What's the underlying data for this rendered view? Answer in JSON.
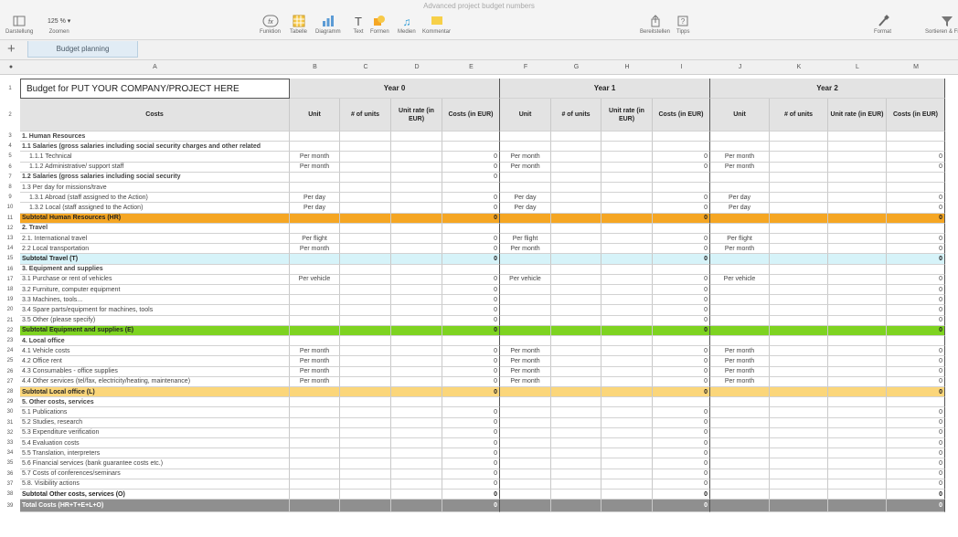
{
  "window_title": "Advanced project budget numbers",
  "toolbar": {
    "left": [
      {
        "label": "Darstellung",
        "icon": "sidebar-icon"
      },
      {
        "label": "Zoomen",
        "value": "125 %",
        "icon": "zoom-icon"
      }
    ],
    "center": [
      {
        "label": "Funktion",
        "icon": "function-icon"
      },
      {
        "label": "Tabelle",
        "icon": "table-icon"
      },
      {
        "label": "Diagramm",
        "icon": "chart-icon"
      },
      {
        "label": "Text",
        "icon": "text-icon"
      },
      {
        "label": "Formen",
        "icon": "shape-icon"
      },
      {
        "label": "Medien",
        "icon": "media-icon"
      },
      {
        "label": "Kommentar",
        "icon": "comment-icon"
      }
    ],
    "right": [
      {
        "label": "Bereitstellen",
        "icon": "share-icon"
      },
      {
        "label": "Tipps",
        "icon": "tips-icon"
      },
      {
        "label": "Format",
        "icon": "format-icon"
      },
      {
        "label": "Sortieren & Filtern",
        "icon": "filter-icon"
      }
    ]
  },
  "sheet_tab": "Budget planning",
  "columns": [
    "A",
    "B",
    "C",
    "D",
    "E",
    "F",
    "G",
    "H",
    "I",
    "J",
    "K",
    "L",
    "M"
  ],
  "title_cell": "Budget for PUT YOUR COMPANY/PROJECT HERE",
  "years": [
    "Year 0",
    "Year 1",
    "Year 2"
  ],
  "header_row": {
    "costs": "Costs",
    "unit": "Unit",
    "units": "# of units",
    "rate0": "Unit rate (in EUR)",
    "rate1": "Unit rate (in EUR)",
    "rate2": "Unit rate (in EUR)",
    "costs_eur": "Costs (in EUR)"
  },
  "rows": [
    {
      "n": "3",
      "label": "1. Human Resources",
      "style": "section"
    },
    {
      "n": "4",
      "label": "1.1 Salaries (gross salaries including social security charges and other related",
      "style": "section-sub"
    },
    {
      "n": "5",
      "label": "1.1.1 Technical",
      "unit": "Per month",
      "v": "0",
      "style": "item"
    },
    {
      "n": "6",
      "label": "1.1.2 Administrative/ support staff",
      "unit": "Per month",
      "v": "0",
      "style": "item"
    },
    {
      "n": "7",
      "label": "1.2 Salaries (gross salaries including social security",
      "v0": "0",
      "style": "section-sub"
    },
    {
      "n": "8",
      "label": "1.3 Per day for missions/trave",
      "style": "plain"
    },
    {
      "n": "9",
      "label": "1.3.1 Abroad (staff assigned to the Action)",
      "unit": "Per day",
      "v": "0",
      "style": "item"
    },
    {
      "n": "10",
      "label": "1.3.2 Local (staff assigned to the Action)",
      "unit": "Per day",
      "v": "0",
      "style": "item"
    },
    {
      "n": "11",
      "label": "Subtotal Human Resources (HR)",
      "v": "0",
      "style": "sub-orange"
    },
    {
      "n": "12",
      "label": "2. Travel",
      "style": "section"
    },
    {
      "n": "13",
      "label": "2.1. International travel",
      "unit": "Per flight",
      "v": "0",
      "style": "plain"
    },
    {
      "n": "14",
      "label": "2.2 Local transportation",
      "unit": "Per month",
      "v": "0",
      "style": "plain"
    },
    {
      "n": "15",
      "label": "Subtotal Travel (T)",
      "v": "0",
      "style": "sub-cyan"
    },
    {
      "n": "16",
      "label": "3. Equipment and supplies",
      "style": "section"
    },
    {
      "n": "17",
      "label": "3.1 Purchase or rent of vehicles",
      "unit": "Per vehicle",
      "v": "0",
      "style": "plain"
    },
    {
      "n": "18",
      "label": "3.2 Furniture, computer equipment",
      "v": "0",
      "style": "plain"
    },
    {
      "n": "19",
      "label": "3.3 Machines, tools...",
      "v": "0",
      "style": "plain"
    },
    {
      "n": "20",
      "label": "3.4 Spare parts/equipment for machines, tools",
      "v": "0",
      "style": "plain"
    },
    {
      "n": "21",
      "label": "3.5 Other (please specify)",
      "v": "0",
      "style": "plain"
    },
    {
      "n": "22",
      "label": "Subtotal Equipment and supplies (E)",
      "v": "0",
      "style": "sub-green"
    },
    {
      "n": "23",
      "label": "4. Local office",
      "style": "section"
    },
    {
      "n": "24",
      "label": "4.1 Vehicle costs",
      "unit": "Per month",
      "v": "0",
      "style": "plain"
    },
    {
      "n": "25",
      "label": "4.2 Office rent",
      "unit": "Per month",
      "v": "0",
      "style": "plain"
    },
    {
      "n": "26",
      "label": "4.3 Consumables - office supplies",
      "unit": "Per month",
      "v": "0",
      "style": "plain"
    },
    {
      "n": "27",
      "label": "4.4 Other services (tel/fax, electricity/heating, maintenance)",
      "unit": "Per month",
      "v": "0",
      "style": "plain"
    },
    {
      "n": "28",
      "label": "Subtotal Local office (L)",
      "v": "0",
      "style": "sub-yellow"
    },
    {
      "n": "29",
      "label": "5. Other costs, services",
      "style": "section"
    },
    {
      "n": "30",
      "label": "5.1 Publications",
      "v": "0",
      "style": "plain"
    },
    {
      "n": "31",
      "label": "5.2 Studies, research",
      "v": "0",
      "style": "plain"
    },
    {
      "n": "32",
      "label": "5.3 Expenditure verification",
      "v": "0",
      "style": "plain"
    },
    {
      "n": "33",
      "label": "5.4 Evaluation costs",
      "v": "0",
      "style": "plain"
    },
    {
      "n": "34",
      "label": "5.5 Translation, interpreters",
      "v": "0",
      "style": "plain"
    },
    {
      "n": "35",
      "label": "5.6 Financial services (bank guarantee costs etc.)",
      "v": "0",
      "style": "plain"
    },
    {
      "n": "36",
      "label": "5.7 Costs of conferences/seminars",
      "v": "0",
      "style": "plain"
    },
    {
      "n": "37",
      "label": "5.8. Visibility actions",
      "v": "0",
      "style": "plain"
    },
    {
      "n": "38",
      "label": "Subtotal Other costs, services (O)",
      "v": "0",
      "style": "sub-white"
    },
    {
      "n": "39",
      "label": "Total Costs (HR+T+E+L+O)",
      "v": "0",
      "style": "total"
    }
  ],
  "colors": {
    "orange": "#f5a623",
    "cyan": "#d6f3f9",
    "green": "#7ed321",
    "yellow": "#fbd67a",
    "total": "#8f8f8f",
    "header_gray": "#e3e3e3"
  }
}
